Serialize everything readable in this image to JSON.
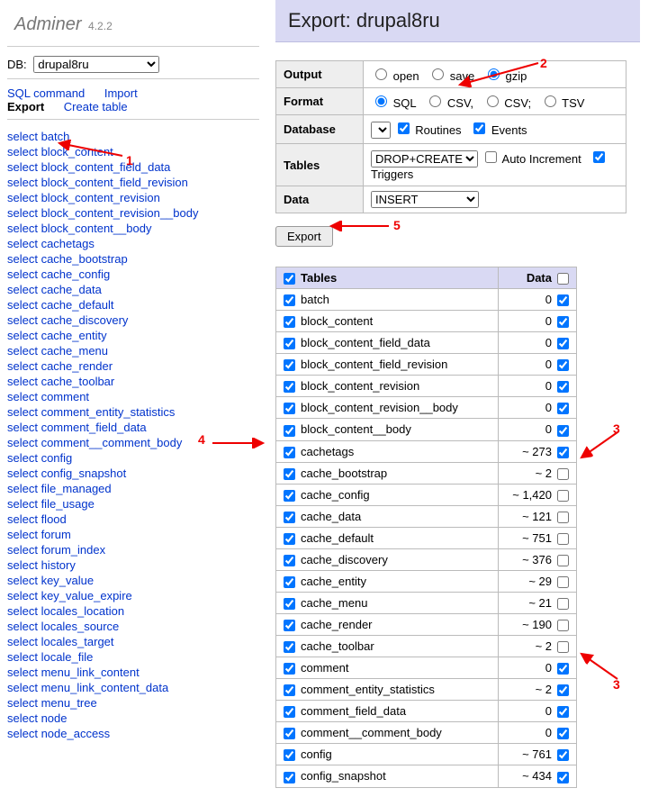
{
  "brand": {
    "name": "Adminer",
    "version": "4.2.2"
  },
  "dbLabel": "DB:",
  "dbSelected": "drupal8ru",
  "menu": {
    "sql": "SQL command",
    "import": "Import",
    "export": "Export",
    "create": "Create table"
  },
  "sideTables": [
    "batch",
    "block_content",
    "block_content_field_data",
    "block_content_field_revision",
    "block_content_revision",
    "block_content_revision__body",
    "block_content__body",
    "cachetags",
    "cache_bootstrap",
    "cache_config",
    "cache_data",
    "cache_default",
    "cache_discovery",
    "cache_entity",
    "cache_menu",
    "cache_render",
    "cache_toolbar",
    "comment",
    "comment_entity_statistics",
    "comment_field_data",
    "comment__comment_body",
    "config",
    "config_snapshot",
    "file_managed",
    "file_usage",
    "flood",
    "forum",
    "forum_index",
    "history",
    "key_value",
    "key_value_expire",
    "locales_location",
    "locales_source",
    "locales_target",
    "locale_file",
    "menu_link_content",
    "menu_link_content_data",
    "menu_tree",
    "node",
    "node_access"
  ],
  "sidePrefix": "select ",
  "title": {
    "prefix": "Export: ",
    "db": "drupal8ru"
  },
  "cfg": {
    "outputLabel": "Output",
    "output": {
      "open": "open",
      "save": "save",
      "gzip": "gzip",
      "selected": "gzip"
    },
    "formatLabel": "Format",
    "format": {
      "sql": "SQL",
      "csv1": "CSV,",
      "csv2": "CSV;",
      "tsv": "TSV",
      "selected": "sql"
    },
    "databaseLabel": "Database",
    "database": {
      "routines": "Routines",
      "events": "Events"
    },
    "tablesLabel": "Tables",
    "tables": {
      "mode": "DROP+CREATE",
      "ai": "Auto Increment",
      "triggers": "Triggers"
    },
    "dataLabel": "Data",
    "data": {
      "mode": "INSERT"
    }
  },
  "exportBtn": "Export",
  "tableHead": {
    "tables": "Tables",
    "data": "Data"
  },
  "tables": [
    {
      "name": "batch",
      "count": "0",
      "data": true
    },
    {
      "name": "block_content",
      "count": "0",
      "data": true
    },
    {
      "name": "block_content_field_data",
      "count": "0",
      "data": true
    },
    {
      "name": "block_content_field_revision",
      "count": "0",
      "data": true
    },
    {
      "name": "block_content_revision",
      "count": "0",
      "data": true
    },
    {
      "name": "block_content_revision__body",
      "count": "0",
      "data": true
    },
    {
      "name": "block_content__body",
      "count": "0",
      "data": true
    },
    {
      "name": "cachetags",
      "count": "~ 273",
      "data": true
    },
    {
      "name": "cache_bootstrap",
      "count": "~ 2",
      "data": false
    },
    {
      "name": "cache_config",
      "count": "~ 1,420",
      "data": false
    },
    {
      "name": "cache_data",
      "count": "~ 121",
      "data": false
    },
    {
      "name": "cache_default",
      "count": "~ 751",
      "data": false
    },
    {
      "name": "cache_discovery",
      "count": "~ 376",
      "data": false
    },
    {
      "name": "cache_entity",
      "count": "~ 29",
      "data": false
    },
    {
      "name": "cache_menu",
      "count": "~ 21",
      "data": false
    },
    {
      "name": "cache_render",
      "count": "~ 190",
      "data": false
    },
    {
      "name": "cache_toolbar",
      "count": "~ 2",
      "data": false
    },
    {
      "name": "comment",
      "count": "0",
      "data": true
    },
    {
      "name": "comment_entity_statistics",
      "count": "~ 2",
      "data": true
    },
    {
      "name": "comment_field_data",
      "count": "0",
      "data": true
    },
    {
      "name": "comment__comment_body",
      "count": "0",
      "data": true
    },
    {
      "name": "config",
      "count": "~ 761",
      "data": true
    },
    {
      "name": "config_snapshot",
      "count": "~ 434",
      "data": true
    }
  ],
  "annotations": {
    "n1": "1",
    "n2": "2",
    "n3": "3",
    "n4": "4",
    "n5": "5"
  }
}
